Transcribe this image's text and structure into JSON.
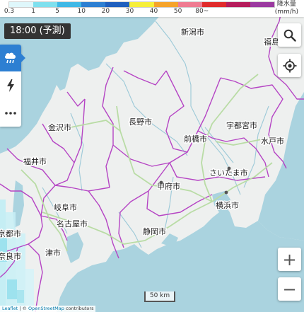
{
  "legend": {
    "colors": [
      "#dff7fb",
      "#7fe0ee",
      "#3fb8e6",
      "#2d7fd2",
      "#1f5fbe",
      "#f6ef3a",
      "#f5a32a",
      "#ef7b91",
      "#e02b2b",
      "#b51c5b",
      "#9b3aa0"
    ],
    "ticks": [
      "0.3",
      "1",
      "5",
      "10",
      "20",
      "30",
      "40",
      "50",
      "80~"
    ],
    "unit_line1": "降水量",
    "unit_line2": "(mm/h)"
  },
  "time_label": "18:00 (予測)",
  "tools": {
    "rain_icon": "rain-cloud-icon",
    "lightning_icon": "lightning-icon",
    "more_icon": "more-dots-icon"
  },
  "controls": {
    "search_icon": "search-icon",
    "locate_icon": "locate-icon",
    "zoom_in": "+",
    "zoom_out": "−"
  },
  "scale_label": "50 km",
  "attribution": {
    "leaflet": "Leaflet",
    "sep": " | © ",
    "osm": "OpenStreetMap",
    "contributors": " contributors"
  },
  "cities": {
    "niigata": "新潟市",
    "fukushima": "福島",
    "nagano": "長野市",
    "kanazawa": "金沢市",
    "utsunomiya": "宇都宮市",
    "maebashi": "前橋市",
    "mito": "水戸市",
    "fukui": "福井市",
    "saitama": "さいたま市",
    "kofu": "甲府市",
    "gifu": "岐阜市",
    "yokohama": "横浜市",
    "kyoto": "京都市",
    "nagoya": "名古屋市",
    "shizuoka": "静岡市",
    "tsu": "津市",
    "nara": "奈良市"
  }
}
